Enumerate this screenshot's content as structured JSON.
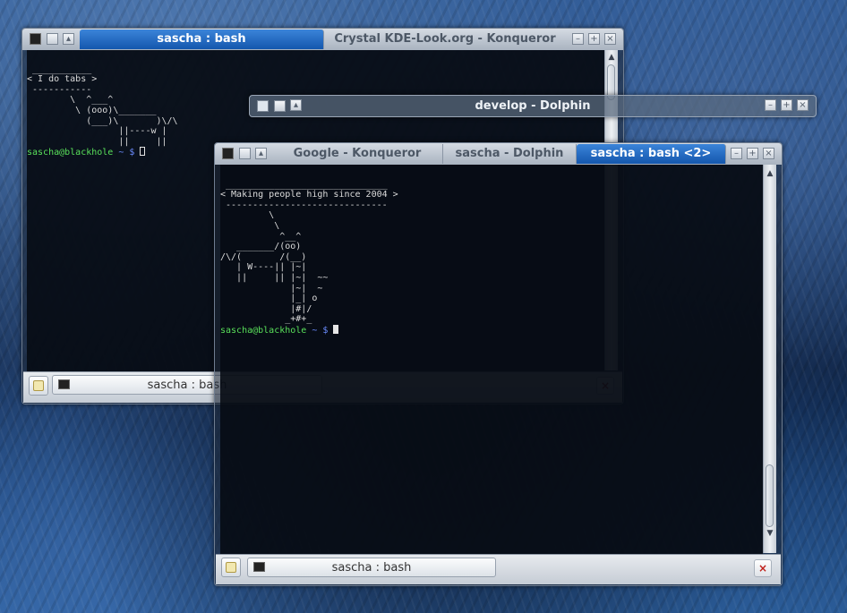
{
  "w1": {
    "tab_active": "sascha : bash",
    "tab_inactive": "Crystal KDE-Look.org - Konqueror",
    "output": " ___________\n< I do tabs >\n -----------\n        \\  ^___^\n         \\ (ooo)\\_______\n           (___)\\       )\\/\\\n                 ||----w |\n                 ||     ||",
    "prompt": "sascha@blackhole",
    "prompt_path": " ~ $ ",
    "session": "sascha : bash"
  },
  "w2": {
    "title": "develop - Dolphin"
  },
  "w3": {
    "tab1": "Google - Konqueror",
    "tab2": "sascha - Dolphin",
    "tab3": "sascha : bash <2>",
    "output": " ______________________________\n< Making people high since 2004 >\n ------------------------------\n         \\\n          \\\n           ^__^\n   _______/(oo)\n/\\/(       /(__)\n   | W----|| |~|\n   ||     || |~|  ~~\n             |~|  ~\n             |_| o\n             |#|/\n            _+#+_",
    "prompt": "sascha@blackhole",
    "prompt_path": " ~ $ ",
    "session": "sascha : bash"
  },
  "icons": {
    "minimize": "minimize-icon",
    "maximize": "maximize-icon",
    "close": "close-icon",
    "terminal": "terminal-icon",
    "new_tab": "new-tab-icon",
    "close_tab": "close-tab-icon"
  }
}
